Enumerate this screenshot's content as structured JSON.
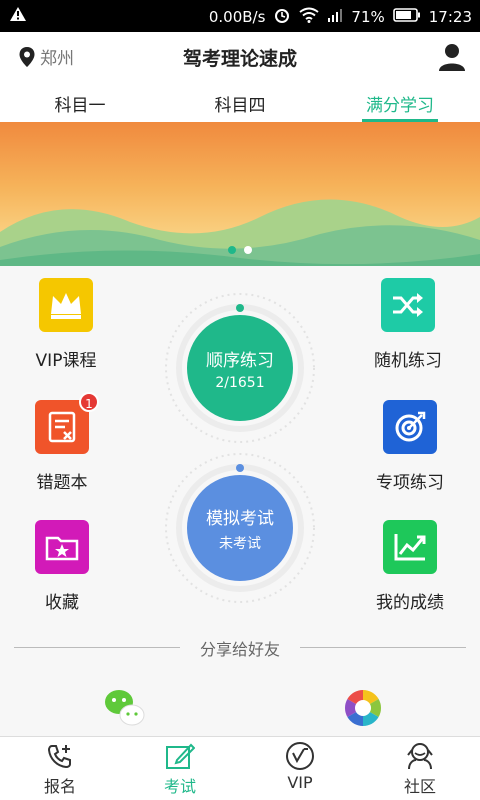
{
  "status_bar": {
    "speed": "0.00B/s",
    "battery": "71%",
    "time": "17:23"
  },
  "header": {
    "location": "郑州",
    "title": "驾考理论速成",
    "user_icon": "user-icon"
  },
  "tabs": [
    {
      "label": "科目一",
      "active": false
    },
    {
      "label": "科目四",
      "active": false
    },
    {
      "label": "满分学习",
      "active": true
    }
  ],
  "banner": {
    "page_count": 2,
    "active_page": 1
  },
  "features": {
    "vip": {
      "label": "VIP课程",
      "icon": "crown-icon",
      "color": "#f5c700"
    },
    "random": {
      "label": "随机练习",
      "icon": "shuffle-icon",
      "color": "#1ecba6"
    },
    "wrong": {
      "label": "错题本",
      "icon": "wrong-book-icon",
      "color": "#f0542a",
      "badge": "1"
    },
    "special": {
      "label": "专项练习",
      "icon": "target-icon",
      "color": "#1f63d6"
    },
    "favorite": {
      "label": "收藏",
      "icon": "star-folder-icon",
      "color": "#d21ab8"
    },
    "score": {
      "label": "我的成绩",
      "icon": "chart-icon",
      "color": "#1ec85a"
    }
  },
  "dials": {
    "sequential": {
      "title": "顺序练习",
      "progress": "2/1651",
      "color": "#1fb88a"
    },
    "mock": {
      "title": "模拟考试",
      "status": "未考试",
      "color": "#5b8fe0"
    }
  },
  "share": {
    "title": "分享给好友",
    "icons": [
      "wechat-icon",
      "moments-icon"
    ]
  },
  "bottom_nav": [
    {
      "label": "报名",
      "icon": "phone-add-icon",
      "active": false
    },
    {
      "label": "考试",
      "icon": "edit-icon",
      "active": true
    },
    {
      "label": "VIP",
      "icon": "vip-icon",
      "active": false
    },
    {
      "label": "社区",
      "icon": "community-icon",
      "active": false
    }
  ]
}
